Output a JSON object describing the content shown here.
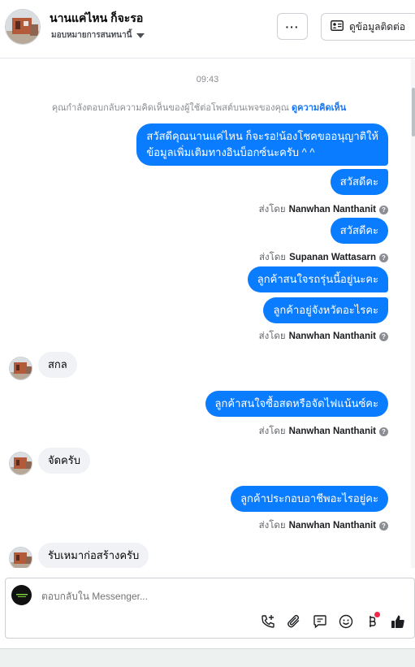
{
  "header": {
    "contact_name": "นานแค่ไหน ก็จะรอ",
    "assign_label": "มอบหมายการสนทนานี้",
    "more_label": "···",
    "view_info_label": "ดูข้อมูลติดต่อ"
  },
  "thread": {
    "timestamp": "09:43",
    "reply_note": "คุณกำลังตอบกลับความคิดเห็นของผู้ใช้ต่อโพสต์บนเพจของคุณ",
    "reply_note_link": "ดูความคิดเห็น",
    "messages": [
      {
        "line1": "สวัสดีคุณนานแค่ไหน ก็จะรอ!น้องโชคขออนุญาติให้",
        "line2": "ข้อมูลเพิ่มเติมทางอินบ็อกซ์นะครับ ^ ^"
      },
      {
        "text": "สวัสดีคะ"
      },
      {
        "sent_prefix": "ส่งโดย",
        "sender": "Nanwhan Nanthanit"
      },
      {
        "text": "สวัสดีคะ"
      },
      {
        "sent_prefix": "ส่งโดย",
        "sender": "Supanan Wattasarn"
      },
      {
        "text": "ลูกค้าสนใจรถรุ่นนี้อยู่นะคะ"
      },
      {
        "text": "ลูกค้าอยู่จังหวัดอะไรคะ"
      },
      {
        "sent_prefix": "ส่งโดย",
        "sender": "Nanwhan Nanthanit"
      },
      {
        "text": "สกล"
      },
      {
        "text": "ลูกค้าสนใจซื้อสดหรือจัดไฟแน้นซ์คะ"
      },
      {
        "sent_prefix": "ส่งโดย",
        "sender": "Nanwhan Nanthanit"
      },
      {
        "text": "จัดครับ"
      },
      {
        "text": "ลูกค้าประกอบอาชีพอะไรอยู่คะ"
      },
      {
        "sent_prefix": "ส่งโดย",
        "sender": "Nanwhan Nanthanit"
      },
      {
        "text": "รับเหมาก่อสร้างครับ"
      }
    ]
  },
  "composer": {
    "placeholder": "ตอบกลับใน Messenger..."
  },
  "colors": {
    "outgoing_bubble": "#0a7cff",
    "incoming_bubble": "#f0f2f5",
    "link": "#1876f2",
    "notification_dot": "#f02849"
  },
  "icons": [
    "more-icon",
    "contact-card-icon",
    "help-icon",
    "add-call-icon",
    "attachment-icon",
    "saved-reply-icon",
    "emoji-icon",
    "payment-icon",
    "like-icon"
  ]
}
